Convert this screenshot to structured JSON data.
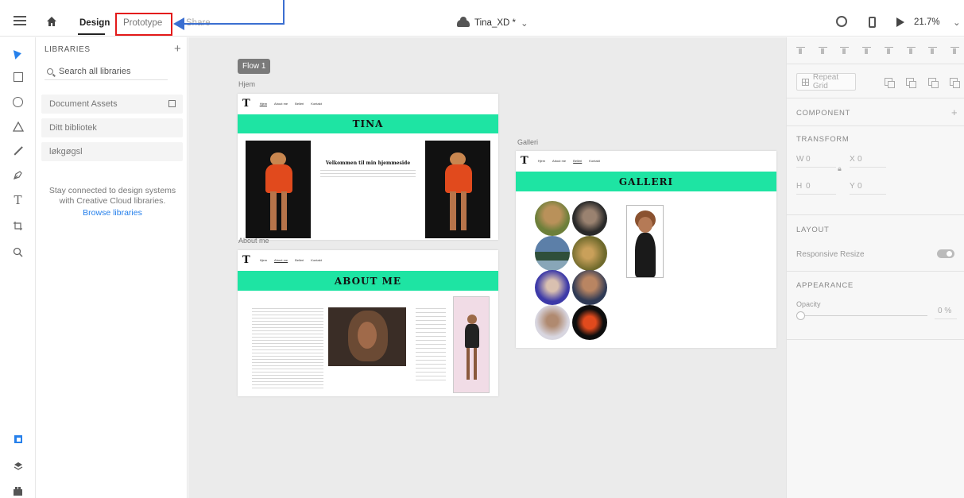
{
  "topbar": {
    "tabs": {
      "design": "Design",
      "prototype": "Prototype",
      "share": "Share"
    },
    "document_name": "Tina_XD *",
    "zoom": "21.7%"
  },
  "libraries": {
    "title": "LIBRARIES",
    "search_placeholder": "Search all libraries",
    "items": [
      "Document Assets",
      "Ditt bibliotek",
      "løkgøgsl"
    ],
    "message": "Stay connected to design systems with Creative Cloud libraries.",
    "link": "Browse libraries"
  },
  "canvas": {
    "flow": "Flow 1",
    "artboards": {
      "hjem": {
        "label": "Hjem",
        "logo": "T",
        "nav": [
          "Hjem",
          "About me",
          "Belleri",
          "Kontakt"
        ],
        "banner": "TINA",
        "heading": "Velkommen til min hjemmeside"
      },
      "about": {
        "label": "About me",
        "logo": "T",
        "nav": [
          "Hjem",
          "About me",
          "Belleri",
          "Kontakt"
        ],
        "banner": "ABOUT ME"
      },
      "galleri": {
        "label": "Galleri",
        "logo": "T",
        "nav": [
          "Hjem",
          "About me",
          "Belleri",
          "Kontakt"
        ],
        "banner": "GALLERI"
      }
    }
  },
  "properties": {
    "repeat_grid": "Repeat Grid",
    "component": "COMPONENT",
    "transform": "TRANSFORM",
    "w_label": "W",
    "w_value": "0",
    "h_label": "H",
    "h_value": "0",
    "x_label": "X",
    "x_value": "0",
    "y_label": "Y",
    "y_value": "0",
    "layout": "LAYOUT",
    "responsive_resize": "Responsive Resize",
    "appearance": "APPEARANCE",
    "opacity_label": "Opacity",
    "opacity_value": "0 %",
    "opacity_fraction": 0
  },
  "colors": {
    "accent": "#2680eb",
    "banner_green": "#1ee4a3",
    "highlight_red": "#e31a1a",
    "arrow_blue": "#3b6fd1"
  }
}
